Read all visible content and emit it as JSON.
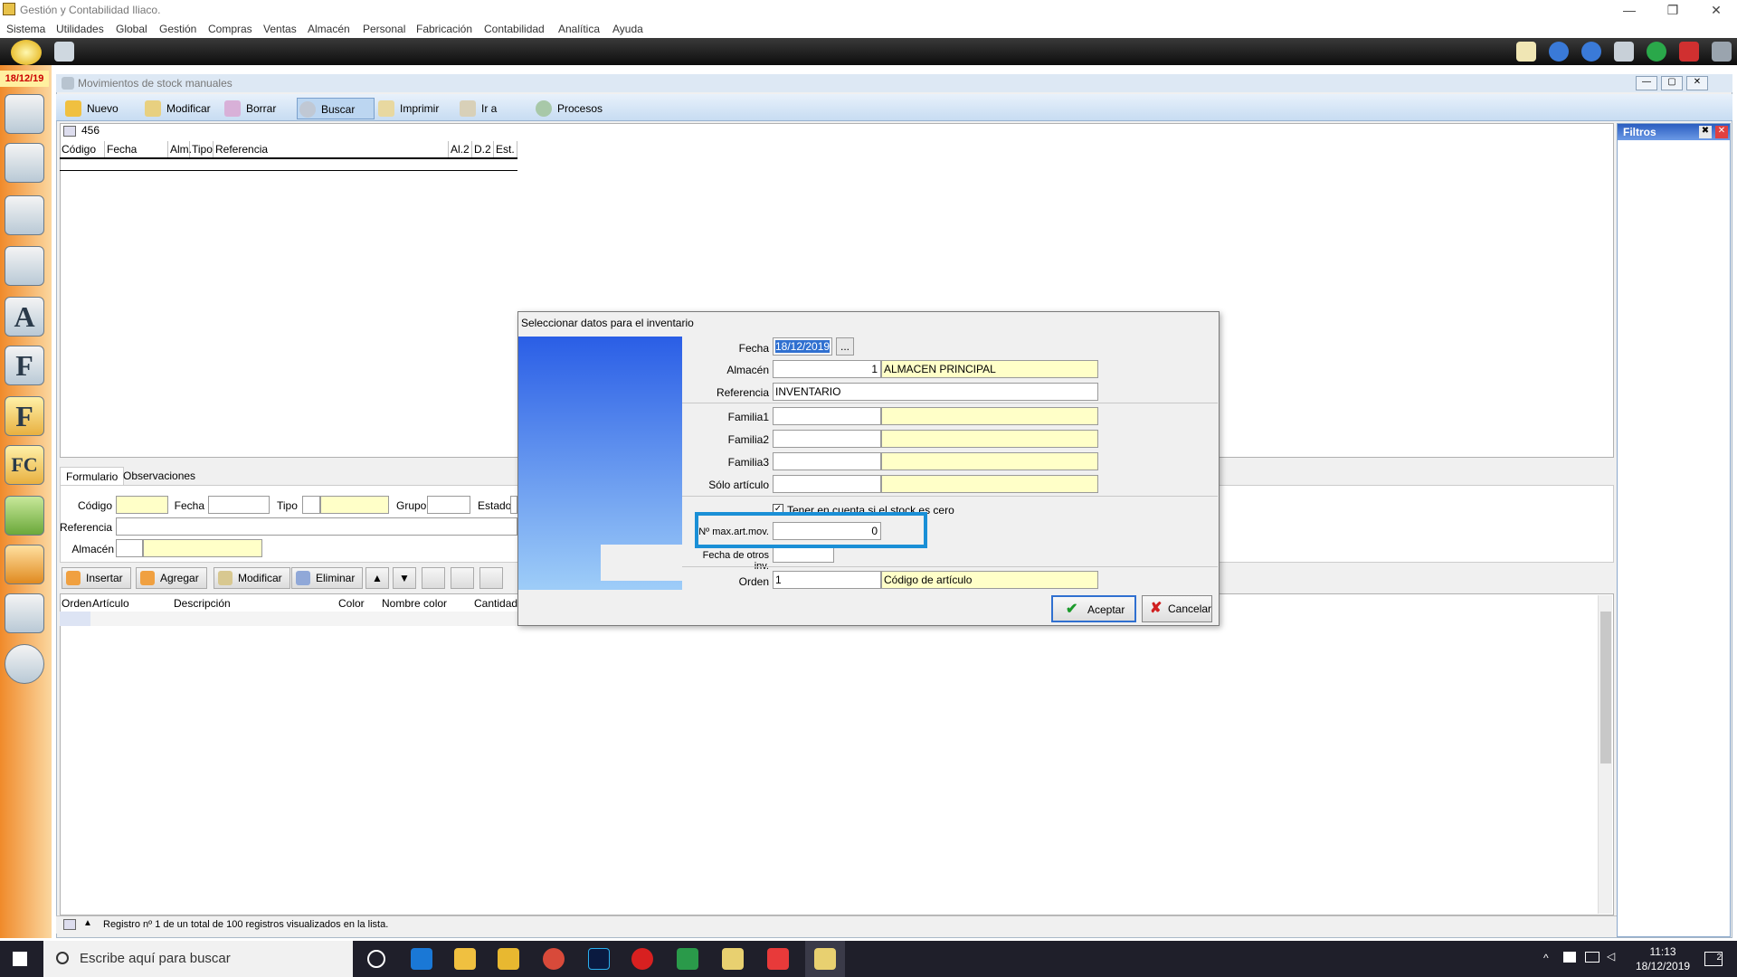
{
  "window": {
    "title": "Gestión y Contabilidad Iliaco."
  },
  "menu": [
    "Sistema",
    "Utilidades",
    "Global",
    "Gestión",
    "Compras",
    "Ventas",
    "Almacén",
    "Personal",
    "Fabricación",
    "Contabilidad",
    "Analítica",
    "Ayuda"
  ],
  "sidebar": {
    "date": "18/12/19",
    "icons": [
      "A",
      "F",
      "F",
      "FC"
    ]
  },
  "subwindow": {
    "title": "Movimientos de stock manuales"
  },
  "toolbar": {
    "nuevo": "Nuevo",
    "modificar": "Modificar",
    "borrar": "Borrar",
    "buscar": "Buscar",
    "imprimir": "Imprimir",
    "ir_a": "Ir a",
    "procesos": "Procesos"
  },
  "list": {
    "count": "456",
    "columns": [
      "Código",
      "Fecha",
      "Alm.",
      "Tipo",
      "Referencia",
      "Al.2",
      "D.2",
      "Est."
    ]
  },
  "filters": {
    "title": "Filtros"
  },
  "form": {
    "tabs": [
      "Formulario",
      "Observaciones"
    ],
    "codigo": "Código",
    "fecha": "Fecha",
    "tipo": "Tipo",
    "grupo": "Grupo",
    "estado": "Estado",
    "referencia": "Referencia",
    "almacen": "Almacén"
  },
  "detail": {
    "buttons": {
      "insertar": "Insertar",
      "agregar": "Agregar",
      "modificar": "Modificar",
      "eliminar": "Eliminar"
    },
    "columns": [
      "Orden",
      "Artículo",
      "Descripción",
      "Color",
      "Nombre color",
      "Cantidad"
    ]
  },
  "status": {
    "text": "Registro nº 1 de un total de 100 registros visualizados en la lista."
  },
  "dialog": {
    "title": "Seleccionar datos para el inventario",
    "fecha_label": "Fecha",
    "fecha_value": "18/12/2019",
    "fecha_btn": "...",
    "almacen_label": "Almacén",
    "almacen_code": "1",
    "almacen_name": "ALMACEN PRINCIPAL",
    "referencia_label": "Referencia",
    "referencia_value": "INVENTARIO",
    "familia1_label": "Familia1",
    "familia2_label": "Familia2",
    "familia3_label": "Familia3",
    "solo_articulo_label": "Sólo artículo",
    "checkbox_label": "Tener en cuenta si el stock es cero",
    "max_label": "Nº max.art.mov.",
    "max_value": "0",
    "fecha_otros_label": "Fecha de otros inv.",
    "orden_label": "Orden",
    "orden_code": "1",
    "orden_name": "Código de artículo",
    "aceptar": "Aceptar",
    "cancelar": "Cancelar"
  },
  "taskbar": {
    "search_placeholder": "Escribe aquí para buscar",
    "time": "11:13",
    "date": "18/12/2019",
    "notifications": "2"
  }
}
